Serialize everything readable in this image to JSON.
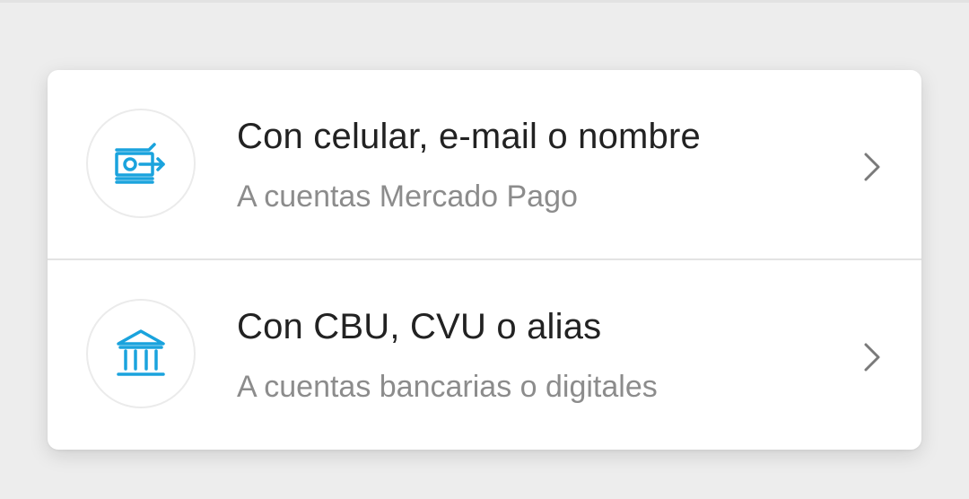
{
  "options": [
    {
      "title": "Con celular, e-mail o nombre",
      "subtitle": "A cuentas Mercado Pago",
      "icon": "money-transfer-icon"
    },
    {
      "title": "Con CBU, CVU o alias",
      "subtitle": "A cuentas bancarias o digitales",
      "icon": "bank-icon"
    }
  ],
  "colors": {
    "accent": "#1aa3dd",
    "title": "#222222",
    "subtitle": "#8c8c8c",
    "background": "#ededed",
    "card": "#ffffff"
  }
}
